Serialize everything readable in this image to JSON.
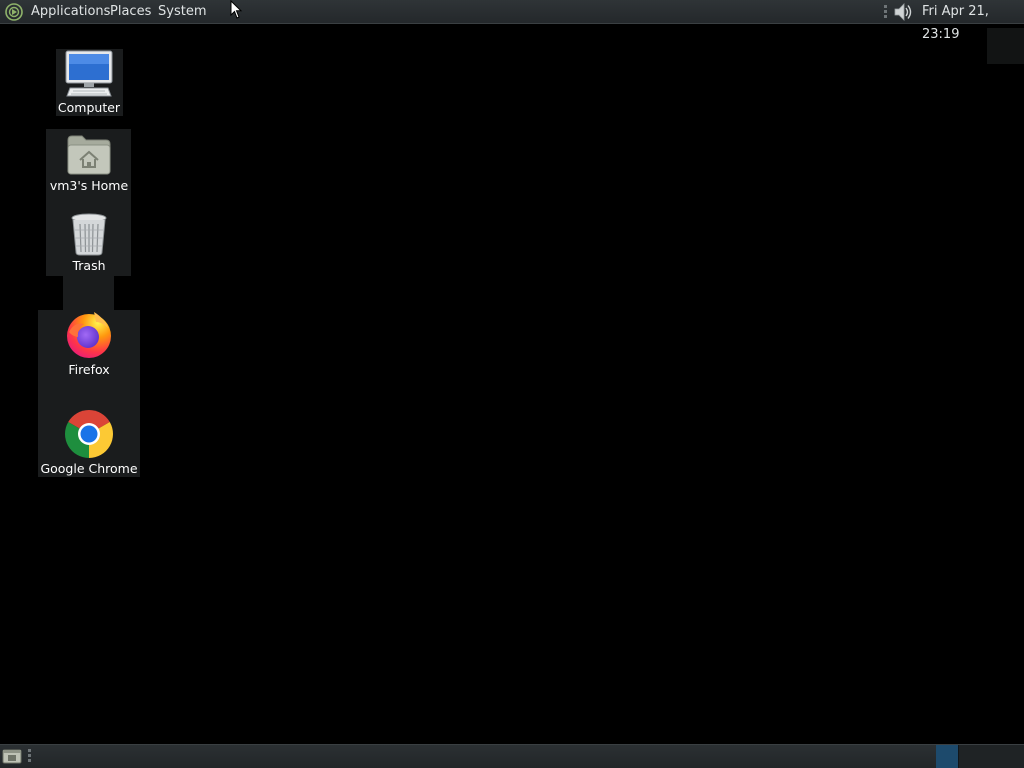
{
  "top_panel": {
    "menus": [
      {
        "label": "Applications"
      },
      {
        "label": "Places"
      },
      {
        "label": "System"
      }
    ],
    "tray": {
      "volume_icon": "speaker-icon",
      "clock": "Fri Apr 21, 23:19"
    }
  },
  "desktop": {
    "icons": [
      {
        "label": "Computer",
        "icon": "computer-icon"
      },
      {
        "label": "vm3's Home",
        "icon": "home-folder-icon"
      },
      {
        "label": "Trash",
        "icon": "trash-icon"
      },
      {
        "label": "Firefox",
        "icon": "firefox-icon"
      },
      {
        "label": "Google Chrome",
        "icon": "chrome-icon"
      }
    ]
  },
  "bottom_panel": {
    "show_desktop_icon": "show-desktop-icon",
    "workspaces": [
      "workspace-1",
      "workspace-2"
    ],
    "active_workspace": 1
  },
  "colors": {
    "desktop_background": "#000000",
    "panel": "#2b3033",
    "panel_text": "#dfe3e4",
    "active_workspace": "#1d4a6c"
  }
}
